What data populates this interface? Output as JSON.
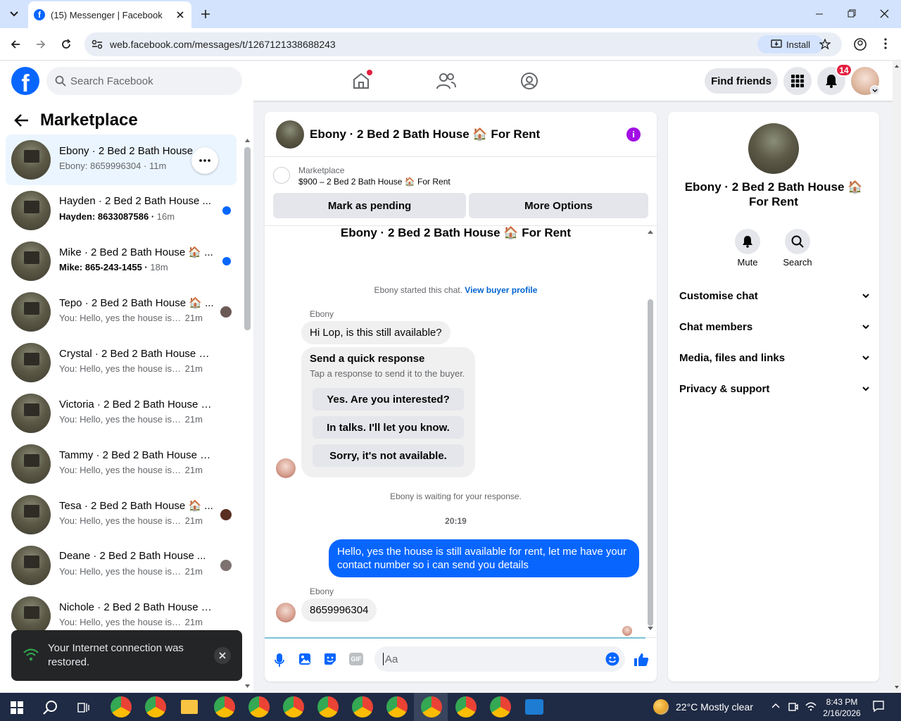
{
  "browser": {
    "tab_title": "(15) Messenger | Facebook",
    "url": "web.facebook.com/messages/t/1267121338688243",
    "install_label": "Install"
  },
  "header": {
    "search_placeholder": "Search Facebook",
    "find_friends": "Find friends",
    "notifications_count": "14"
  },
  "left": {
    "title": "Marketplace",
    "conversations": [
      {
        "name": "Ebony · 2 Bed 2 Bath House 🏠 ...",
        "preview": "Ebony: 8659996304",
        "time": "11m"
      },
      {
        "name": "Hayden · 2 Bed 2 Bath House ...",
        "preview": "Hayden: 8633087586",
        "time": "16m"
      },
      {
        "name": "Mike · 2 Bed 2 Bath House 🏠 ...",
        "preview": "Mike: 865-243-1455",
        "time": "18m"
      },
      {
        "name": "Tepo · 2 Bed 2 Bath House 🏠 ...",
        "preview": "You: Hello, yes the house is stil...",
        "time": "21m"
      },
      {
        "name": "Crystal · 2 Bed 2 Bath House 🏠 ...",
        "preview": "You: Hello, yes the house is still a...",
        "time": "21m"
      },
      {
        "name": "Victoria · 2 Bed 2 Bath House 🏠...",
        "preview": "You: Hello, yes the house is still a...",
        "time": "21m"
      },
      {
        "name": "Tammy · 2 Bed 2 Bath House 🏠 ...",
        "preview": "You: Hello, yes the house is still a...",
        "time": "21m"
      },
      {
        "name": "Tesa · 2 Bed 2 Bath House 🏠 ...",
        "preview": "You: Hello, yes the house is stil...",
        "time": "21m"
      },
      {
        "name": "Deane · 2 Bed 2 Bath House ...",
        "preview": "You: Hello, yes the house is stil...",
        "time": "21m"
      },
      {
        "name": "Nichole · 2 Bed 2 Bath House 🏠...",
        "preview": "You: Hello, yes the house is still a...",
        "time": "21m"
      }
    ],
    "toast": "Your Internet connection was restored."
  },
  "chat": {
    "title": "Ebony · 2 Bed 2 Bath House 🏠 For Rent",
    "listing_source": "Marketplace",
    "listing_price": "$900 – 2 Bed 2 Bath House 🏠 For Rent",
    "mark_pending": "Mark as pending",
    "more_options": "More Options",
    "thread_title": "Ebony · 2 Bed 2 Bath House 🏠 For Rent",
    "started_text": "Ebony started this chat.",
    "view_buyer": "View buyer profile",
    "sender": "Ebony",
    "msg1": "Hi Lop, is this still available?",
    "quick_title": "Send a quick response",
    "quick_sub": "Tap a response to send it to the buyer.",
    "quick1": "Yes. Are you interested?",
    "quick2": "In talks. I'll let you know.",
    "quick3": "Sorry, it's not available.",
    "waiting": "Ebony is waiting for your response.",
    "time": "20:19",
    "msg_out": "Hello, yes the house is still available for rent, let me have your contact number so i can send you  details",
    "msg2": "8659996304",
    "composer_placeholder": "Aa"
  },
  "right": {
    "name": "Ebony · 2 Bed 2 Bath House 🏠 For Rent",
    "mute": "Mute",
    "search": "Search",
    "items": [
      "Customise chat",
      "Chat members",
      "Media, files and links",
      "Privacy & support"
    ]
  },
  "taskbar": {
    "weather": "22°C  Mostly clear",
    "time": "8:43 PM",
    "date": "2/16/2026"
  },
  "colors": {
    "accent": "#0866ff",
    "purple": "#a20ee4"
  }
}
